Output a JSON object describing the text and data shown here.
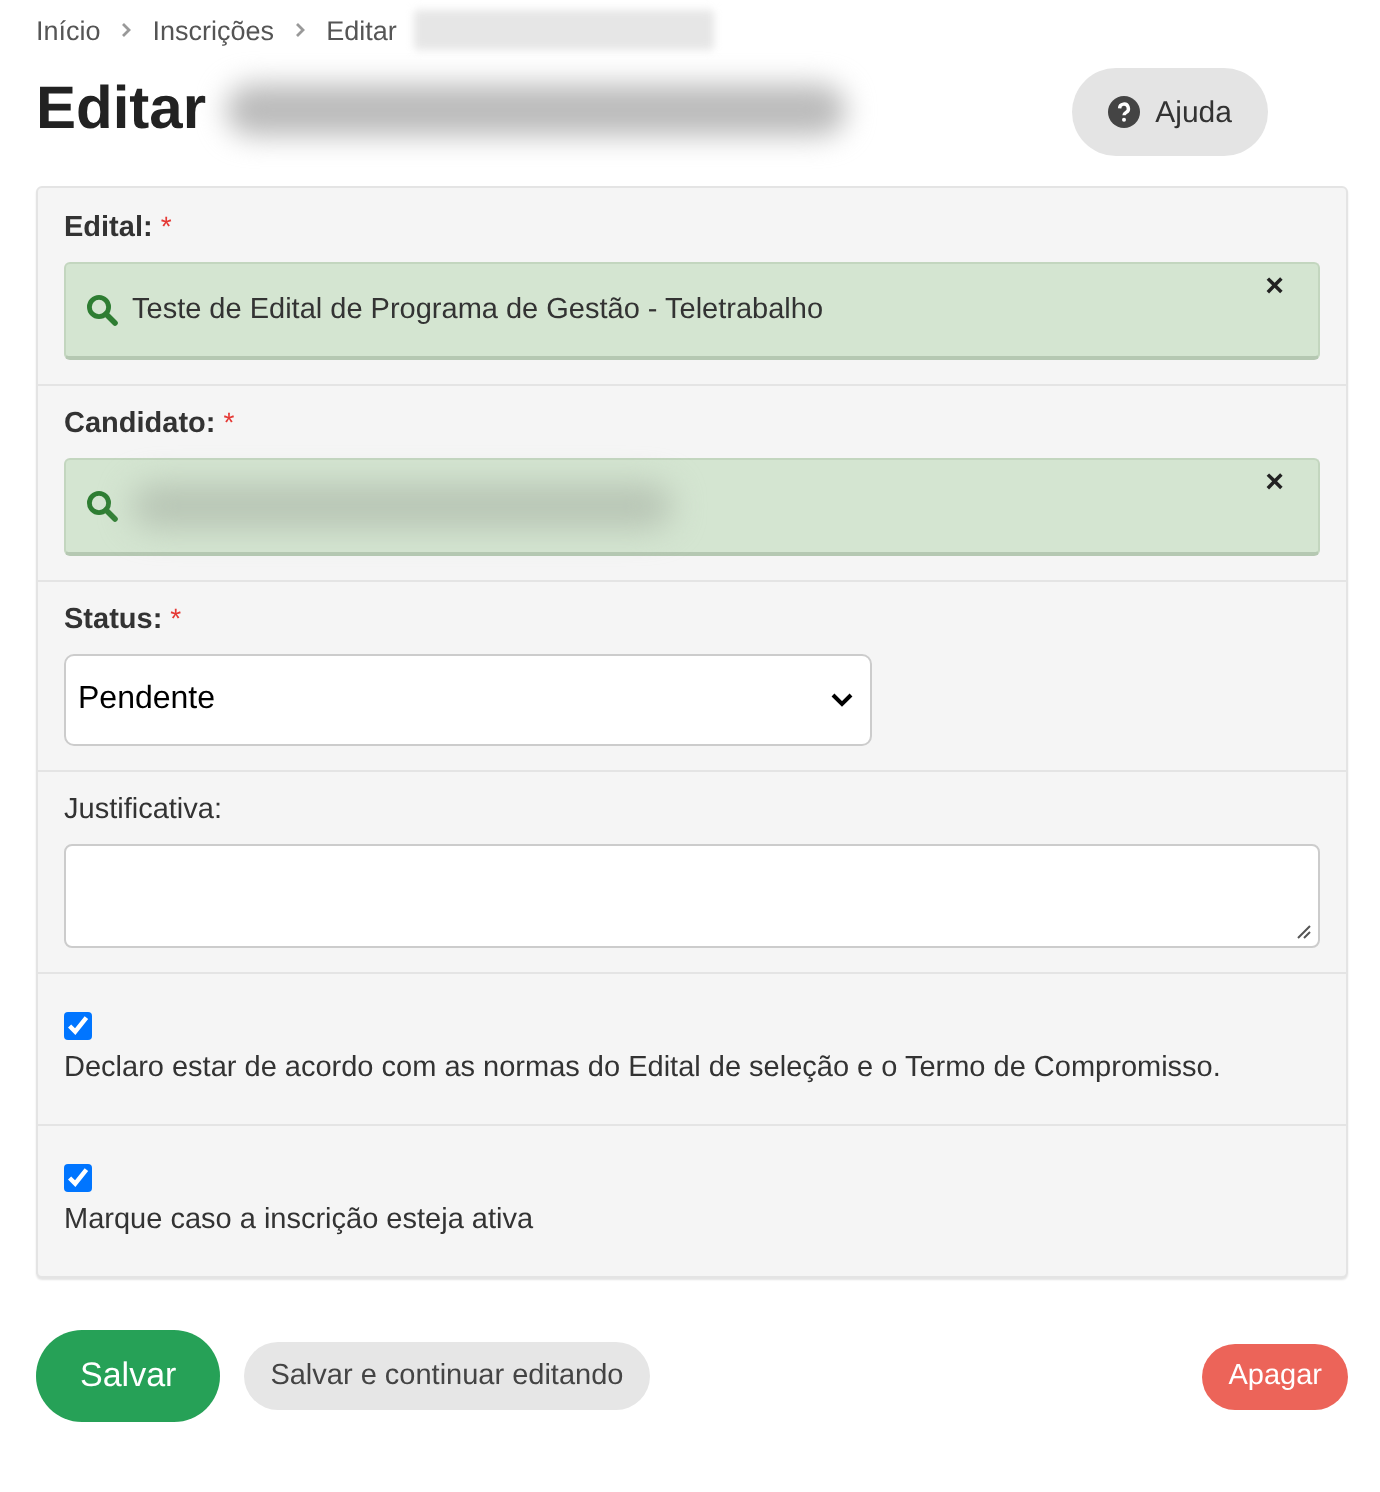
{
  "breadcrumb": [
    {
      "label": "Início"
    },
    {
      "label": "Inscrições"
    },
    {
      "label": "Editar"
    }
  ],
  "title": "Editar",
  "help_button": {
    "label": "Ajuda"
  },
  "fields": [
    {
      "kind": "lookup",
      "label": "Edital:",
      "required_mark": "*",
      "value": "Teste de Edital de Programa de Gestão - Teletrabalho",
      "clear": "×"
    },
    {
      "kind": "lookup",
      "label": "Candidato:",
      "required_mark": "*",
      "clear": "×"
    },
    {
      "kind": "select",
      "label": "Status:",
      "required_mark": "*",
      "value": "Pendente"
    },
    {
      "kind": "textarea",
      "label": "Justificativa:"
    },
    {
      "kind": "checkbox",
      "label": "Declaro estar de acordo com as normas do Edital de seleção e o Termo de Compromisso.",
      "checked": true
    },
    {
      "kind": "checkbox",
      "label": "Marque caso a inscrição esteja ativa",
      "checked": true
    }
  ],
  "actions": {
    "save": "Salvar",
    "save_continue": "Salvar e continuar editando",
    "delete": "Apagar"
  }
}
